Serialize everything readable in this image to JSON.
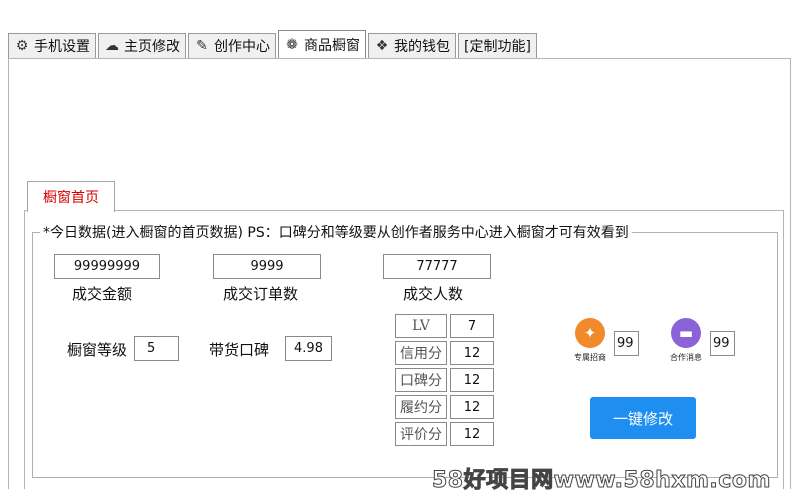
{
  "tabs": [
    {
      "label": "手机设置",
      "icon": "phone-settings-icon",
      "glyph": "⚙"
    },
    {
      "label": "主页修改",
      "icon": "cloud-icon",
      "glyph": "☁"
    },
    {
      "label": "创作中心",
      "icon": "quill-icon",
      "glyph": "✎"
    },
    {
      "label": "商品橱窗",
      "icon": "shop-icon",
      "glyph": "❁"
    },
    {
      "label": "我的钱包",
      "icon": "wallet-icon",
      "glyph": "❖"
    },
    {
      "label": "[定制功能]"
    }
  ],
  "active_tab": 3,
  "subtab": {
    "label": "橱窗首页"
  },
  "group": {
    "title": "*今日数据(进入橱窗的首页数据) PS：口碑分和等级要从创作者服务中心进入橱窗才可有效看到"
  },
  "stats": [
    {
      "value": "99999999",
      "label": "成交金额"
    },
    {
      "value": "9999",
      "label": "成交订单数"
    },
    {
      "value": "77777",
      "label": "成交人数"
    }
  ],
  "level": {
    "label": "橱窗等级",
    "value": "5"
  },
  "reputation": {
    "label": "带货口碑",
    "value": "4.98"
  },
  "scores": [
    {
      "label": "LV",
      "value": "7"
    },
    {
      "label": "信用分",
      "value": "12"
    },
    {
      "label": "口碑分",
      "value": "12"
    },
    {
      "label": "履约分",
      "value": "12"
    },
    {
      "label": "评价分",
      "value": "12"
    }
  ],
  "icons": [
    {
      "caption": "专属招商",
      "value": "99",
      "color": "#f08a2a",
      "icon": "handshake-icon",
      "glyph": "✦"
    },
    {
      "caption": "合作消息",
      "value": "99",
      "color": "#8a63d8",
      "icon": "message-icon",
      "glyph": "▬"
    }
  ],
  "action_button": {
    "label": "一键修改"
  },
  "watermark": "58好项目网www.58hxm.com"
}
